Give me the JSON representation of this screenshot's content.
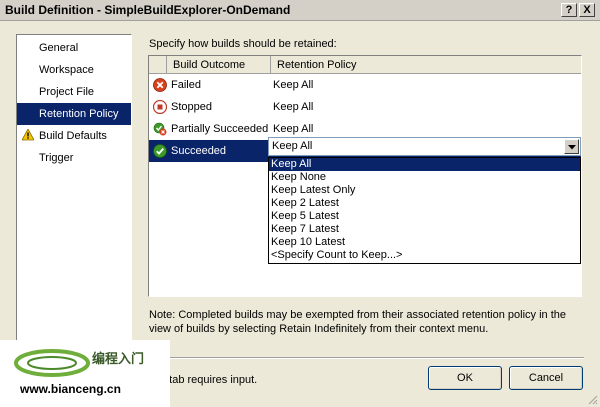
{
  "window": {
    "title": "Build Definition - SimpleBuildExplorer-OnDemand",
    "help_label": "?",
    "close_label": "X"
  },
  "sidebar": {
    "items": [
      {
        "label": "General"
      },
      {
        "label": "Workspace"
      },
      {
        "label": "Project File"
      },
      {
        "label": "Retention Policy"
      },
      {
        "label": "Build Defaults"
      },
      {
        "label": "Trigger"
      }
    ]
  },
  "main": {
    "instruction": "Specify how builds should be retained:",
    "grid": {
      "headers": [
        "Build Outcome",
        "Retention Policy"
      ],
      "rows": [
        {
          "outcome": "Failed",
          "policy": "Keep All",
          "icon": "failed-icon"
        },
        {
          "outcome": "Stopped",
          "policy": "Keep All",
          "icon": "stopped-icon"
        },
        {
          "outcome": "Partially Succeeded",
          "policy": "Keep All",
          "icon": "partially-succeeded-icon"
        },
        {
          "outcome": "Succeeded",
          "policy": "Keep All",
          "icon": "succeeded-icon"
        }
      ]
    },
    "combo": {
      "value": "Keep All",
      "options": [
        "Keep All",
        "Keep None",
        "Keep Latest Only",
        "Keep 2 Latest",
        "Keep 5 Latest",
        "Keep 7 Latest",
        "Keep 10 Latest",
        "<Specify Count to Keep...>"
      ]
    },
    "note": "Note: Completed builds may be exempted from their associated retention policy in the view of builds by selecting Retain Indefinitely from their context menu."
  },
  "footer": {
    "warning_text": "e tab requires input.",
    "ok_label": "OK",
    "cancel_label": "Cancel"
  },
  "watermark": {
    "chinese": "编程入门",
    "url": "www.bianceng.cn"
  },
  "colors": {
    "selection": "#0a246a",
    "dialog_bg": "#ece9d8"
  }
}
